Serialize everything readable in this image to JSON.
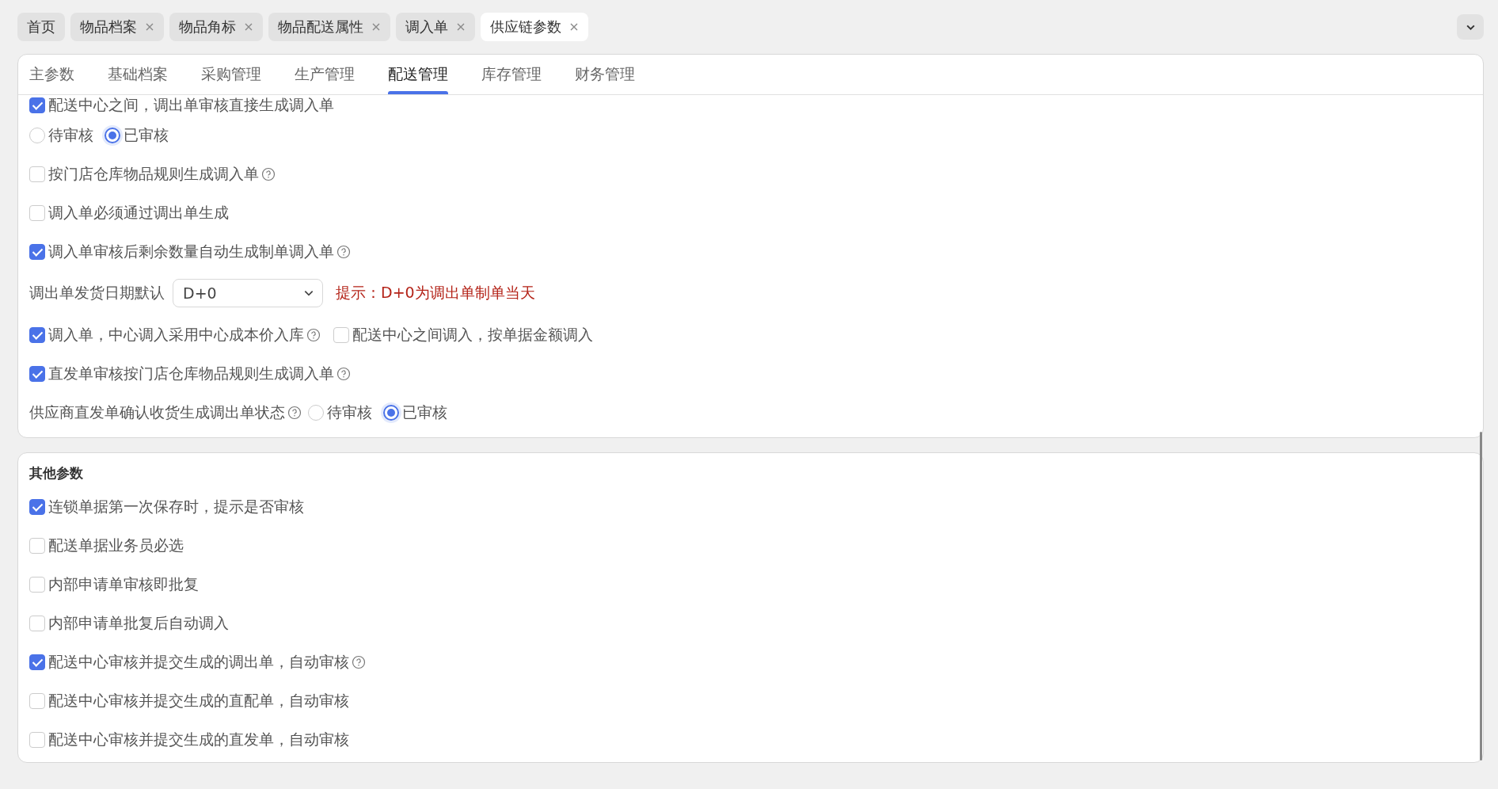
{
  "page_tabs": [
    {
      "label": "首页",
      "closable": false,
      "selected": false
    },
    {
      "label": "物品档案",
      "closable": true,
      "selected": false
    },
    {
      "label": "物品角标",
      "closable": true,
      "selected": false
    },
    {
      "label": "物品配送属性",
      "closable": true,
      "selected": false
    },
    {
      "label": "调入单",
      "closable": true,
      "selected": false
    },
    {
      "label": "供应链参数",
      "closable": true,
      "selected": true
    }
  ],
  "section_tabs": [
    {
      "label": "主参数",
      "selected": false
    },
    {
      "label": "基础档案",
      "selected": false
    },
    {
      "label": "采购管理",
      "selected": false
    },
    {
      "label": "生产管理",
      "selected": false
    },
    {
      "label": "配送管理",
      "selected": true
    },
    {
      "label": "库存管理",
      "selected": false
    },
    {
      "label": "财务管理",
      "selected": false
    }
  ],
  "settings": [
    {
      "kind": "checkbox",
      "label": "配送中心之间，调出单审核直接生成调入单",
      "checked": true,
      "help": false
    },
    {
      "kind": "radios",
      "options": [
        {
          "label": "待审核",
          "selected": false
        },
        {
          "label": "已审核",
          "selected": true
        }
      ]
    },
    {
      "kind": "checkbox",
      "label": "按门店仓库物品规则生成调入单",
      "checked": false,
      "help": true
    },
    {
      "kind": "checkbox",
      "label": "调入单必须通过调出单生成",
      "checked": false,
      "help": false
    },
    {
      "kind": "checkbox",
      "label": "调入单审核后剩余数量自动生成制单调入单",
      "checked": true,
      "help": true
    },
    {
      "kind": "select",
      "label": "调出单发货日期默认",
      "value": "D+0",
      "hint": "提示：D+0为调出单制单当天"
    },
    {
      "kind": "checkboxes",
      "items": [
        {
          "label": "调入单，中心调入采用中心成本价入库",
          "checked": true,
          "help": true
        },
        {
          "label": "配送中心之间调入，按单据金额调入",
          "checked": false,
          "help": false
        }
      ]
    },
    {
      "kind": "checkbox",
      "label": "直发单审核按门店仓库物品规则生成调入单",
      "checked": true,
      "help": true
    },
    {
      "kind": "radios",
      "label": "供应商直发单确认收货生成调出单状态",
      "help": true,
      "options": [
        {
          "label": "待审核",
          "selected": false
        },
        {
          "label": "已审核",
          "selected": true
        }
      ]
    }
  ],
  "other": {
    "title": "其他参数",
    "settings": [
      {
        "kind": "checkbox",
        "label": "连锁单据第一次保存时，提示是否审核",
        "checked": true,
        "help": false
      },
      {
        "kind": "checkbox",
        "label": "配送单据业务员必选",
        "checked": false,
        "help": false
      },
      {
        "kind": "checkbox",
        "label": "内部申请单审核即批复",
        "checked": false,
        "help": false
      },
      {
        "kind": "checkbox",
        "label": "内部申请单批复后自动调入",
        "checked": false,
        "help": false
      },
      {
        "kind": "checkbox",
        "label": "配送中心审核并提交生成的调出单，自动审核",
        "checked": true,
        "help": true
      },
      {
        "kind": "checkbox",
        "label": "配送中心审核并提交生成的直配单，自动审核",
        "checked": false,
        "help": false
      },
      {
        "kind": "checkbox",
        "label": "配送中心审核并提交生成的直发单，自动审核",
        "checked": false,
        "help": false
      }
    ]
  }
}
